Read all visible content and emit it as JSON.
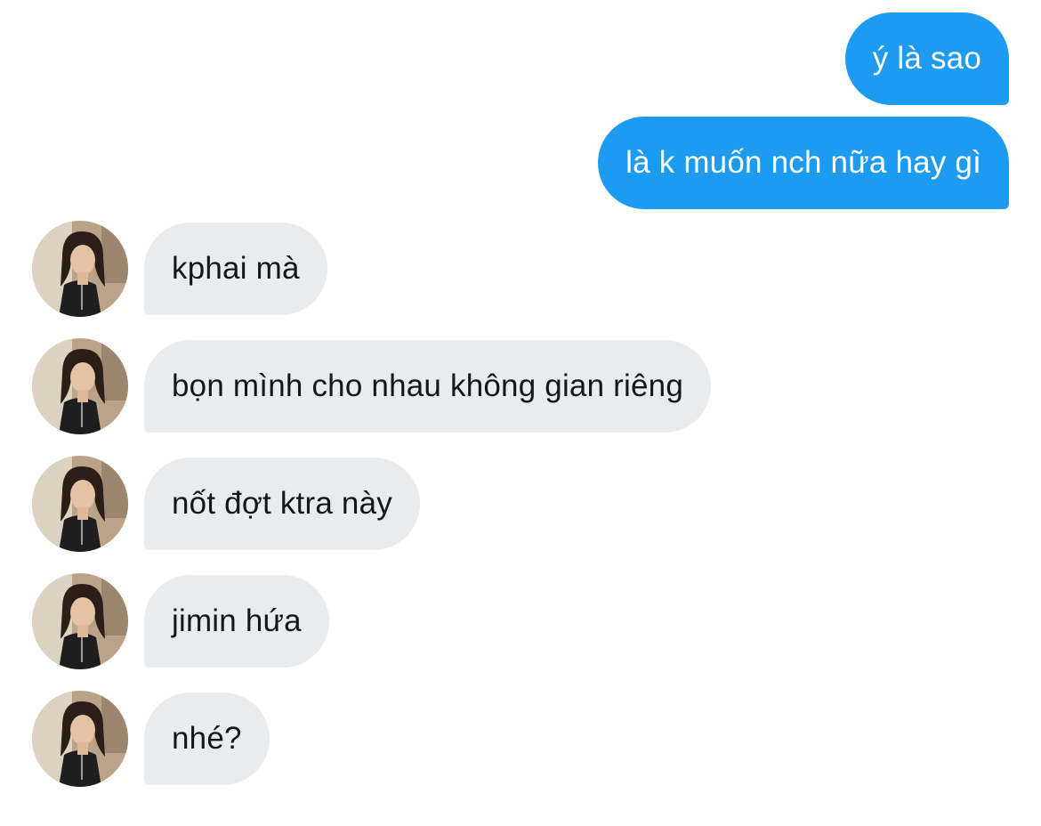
{
  "conversation": {
    "outgoing": [
      {
        "text": "ý là sao"
      },
      {
        "text": "là k muốn nch nữa hay gì"
      }
    ],
    "incoming": [
      {
        "text": "kphai mà"
      },
      {
        "text": "bọn mình cho nhau không gian riêng"
      },
      {
        "text": "nốt đợt ktra này"
      },
      {
        "text": "jimin hứa"
      },
      {
        "text": "nhé?"
      }
    ]
  },
  "colors": {
    "outgoing_bubble": "#1d9bf0",
    "incoming_bubble": "#e8ecef",
    "background": "#ffffff"
  },
  "icons": {
    "sender_avatar": "user-avatar-photo"
  }
}
